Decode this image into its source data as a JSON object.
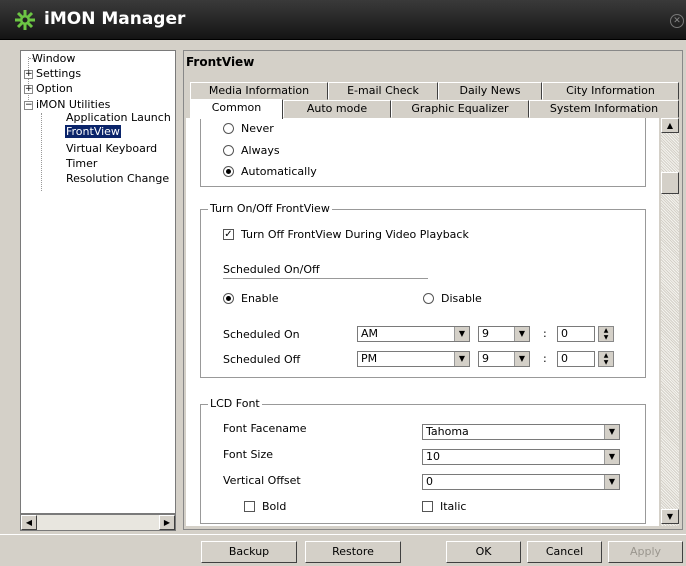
{
  "window": {
    "title": "iMON Manager",
    "close_symbol": "✕"
  },
  "tree": {
    "items": [
      "Window",
      "Settings",
      "Option",
      "iMON Utilities",
      "Application Launch",
      "FrontView",
      "Virtual Keyboard",
      "Timer",
      "Resolution Change"
    ]
  },
  "panel": {
    "title": "FrontView"
  },
  "tabs": {
    "row1": [
      "Media Information",
      "E-mail Check",
      "Daily News",
      "City Information"
    ],
    "row2": [
      "Common",
      "Auto mode",
      "Graphic Equalizer",
      "System Information"
    ],
    "active": "Common"
  },
  "display_mode": {
    "options": [
      "Never",
      "Always",
      "Automatically"
    ],
    "selected": "Automatically"
  },
  "turn_onoff": {
    "group_title": "Turn On/Off FrontView",
    "video_playback_label": "Turn Off FrontView During Video Playback",
    "video_playback_checked": true,
    "scheduled_heading": "Scheduled On/Off",
    "enable_label": "Enable",
    "disable_label": "Disable",
    "enabled": true,
    "on_label": "Scheduled On",
    "off_label": "Scheduled Off",
    "on_ampm": "AM",
    "on_hour": "9",
    "on_min": "0",
    "off_ampm": "PM",
    "off_hour": "9",
    "off_min": "0",
    "colon": ":"
  },
  "lcd_font": {
    "group_title": "LCD Font",
    "facename_label": "Font Facename",
    "facename_value": "Tahoma",
    "size_label": "Font Size",
    "size_value": "10",
    "offset_label": "Vertical Offset",
    "offset_value": "0",
    "bold_label": "Bold",
    "italic_label": "Italic"
  },
  "buttons": {
    "backup": "Backup",
    "restore": "Restore",
    "ok": "OK",
    "cancel": "Cancel",
    "apply": "Apply"
  }
}
